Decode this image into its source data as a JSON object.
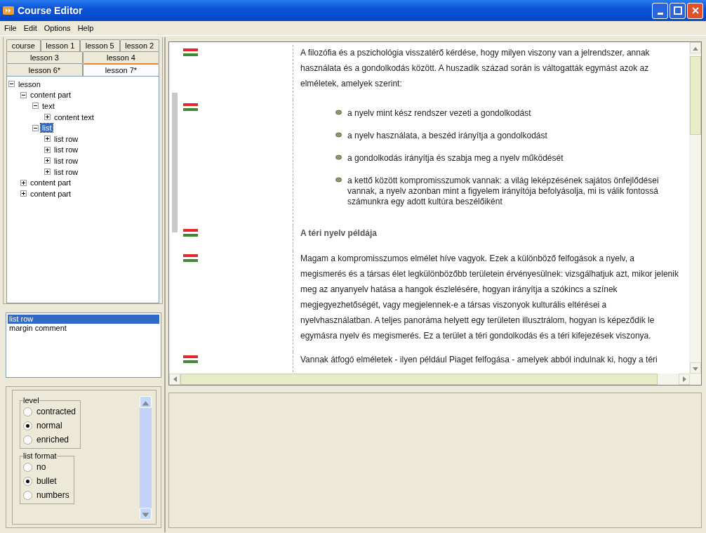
{
  "window": {
    "title": "Course Editor"
  },
  "menu": [
    "File",
    "Edit",
    "Options",
    "Help"
  ],
  "tab_rows": [
    [
      {
        "label": "course",
        "selected": false
      },
      {
        "label": "lesson 1",
        "selected": false
      },
      {
        "label": "lesson 5",
        "selected": false
      },
      {
        "label": "lesson 2",
        "selected": false
      }
    ],
    [
      {
        "label": "lesson 3",
        "selected": false
      },
      {
        "label": "lesson 4",
        "selected": false
      }
    ],
    [
      {
        "label": "lesson 6*",
        "selected": false
      },
      {
        "label": "lesson 7*",
        "selected": true
      }
    ]
  ],
  "tree": [
    {
      "label": "lesson",
      "expanded": true,
      "selected": false,
      "children": [
        {
          "label": "content part",
          "expanded": true,
          "selected": false,
          "children": [
            {
              "label": "text",
              "expanded": true,
              "selected": false,
              "children": [
                {
                  "label": "content text",
                  "expanded": false,
                  "selected": false
                }
              ]
            },
            {
              "label": "list",
              "expanded": true,
              "selected": true,
              "children": [
                {
                  "label": "list row",
                  "expanded": false,
                  "selected": false
                },
                {
                  "label": "list row",
                  "expanded": false,
                  "selected": false
                },
                {
                  "label": "list row",
                  "expanded": false,
                  "selected": false
                },
                {
                  "label": "list row",
                  "expanded": false,
                  "selected": false
                }
              ]
            }
          ]
        },
        {
          "label": "content part",
          "expanded": false,
          "selected": false
        },
        {
          "label": "content part",
          "expanded": false,
          "selected": false
        }
      ]
    }
  ],
  "element_list": [
    {
      "label": "list row",
      "selected": true
    },
    {
      "label": "margin comment",
      "selected": false
    }
  ],
  "properties": [
    {
      "legend": "level",
      "options": [
        {
          "label": "contracted",
          "selected": false
        },
        {
          "label": "normal",
          "selected": true
        },
        {
          "label": "enriched",
          "selected": false
        }
      ]
    },
    {
      "legend": "list format",
      "options": [
        {
          "label": "no",
          "selected": false
        },
        {
          "label": "bullet",
          "selected": true
        },
        {
          "label": "numbers",
          "selected": false
        }
      ]
    }
  ],
  "document": {
    "blocks": [
      {
        "kind": "paragraph",
        "selected": false,
        "text": "A filozófia és a pszichológia visszatérő kérdése, hogy milyen viszony van a jelrendszer, annak használata és a gondolkodás között. A huszadik század során is váltogatták egymást azok az elméletek, amelyek szerint:"
      },
      {
        "kind": "list",
        "selected": true,
        "items": [
          "a nyelv mint kész rendszer vezeti a gondolkodást",
          "a nyelv használata, a beszéd irányítja a gondolkodást",
          "a gondolkodás irányítja és szabja meg a nyelv működését",
          "a kettő között kompromisszumok vannak: a világ leképzésének sajátos önfejlődései vannak, a nyelv azonban mint a figyelem irányítója befolyásolja, mi is válik fontossá számunkra egy adott kultúra beszélőiként"
        ]
      },
      {
        "kind": "heading",
        "selected": false,
        "text": "A téri nyelv példája"
      },
      {
        "kind": "paragraph",
        "selected": false,
        "text": "Magam a kompromisszumos elmélet híve vagyok. Ezek a különböző felfogások a nyelv, a megismerés és a társas élet legkülönbözőbb területein érvényesülnek: vizsgálhatjuk azt, mikor jelenik meg az anyanyelv hatása a hangok észlelésére, hogyan irányítja a szókincs a színek megjegyezhetőségét, vagy megjelennek-e a társas viszonyok kulturális eltérései a nyelvhasználatban. A teljes panoráma helyett egy területen illusztrálom, hogyan is képeződik le egymásra nyelv és megismerés. Ez a terület a téri gondolkodás és a téri kifejezések viszonya."
      },
      {
        "kind": "paragraph",
        "selected": false,
        "text": "Vannak átfogó elméletek - ilyen például Piaget felfogása - amelyek abból indulnak ki, hogy a téri"
      }
    ]
  }
}
